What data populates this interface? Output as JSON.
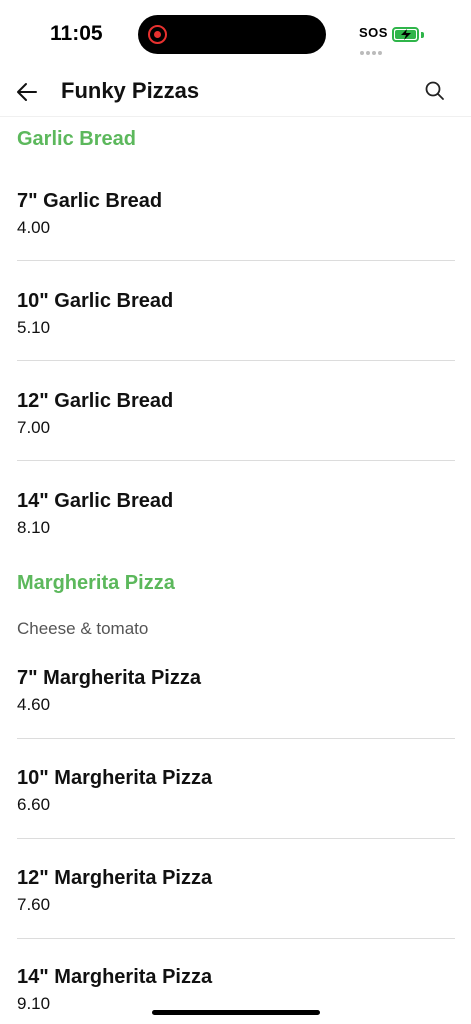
{
  "status": {
    "time": "11:05",
    "sos": "SOS"
  },
  "header": {
    "title": "Funky Pizzas"
  },
  "sections": [
    {
      "title": "Garlic Bread",
      "items": [
        {
          "name": "7\" Garlic Bread",
          "price": "4.00"
        },
        {
          "name": "10\" Garlic Bread",
          "price": "5.10"
        },
        {
          "name": "12\" Garlic Bread",
          "price": "7.00"
        },
        {
          "name": "14\" Garlic Bread",
          "price": "8.10"
        }
      ]
    },
    {
      "title": "Margherita Pizza",
      "description": "Cheese & tomato",
      "items": [
        {
          "name": "7\" Margherita Pizza",
          "price": "4.60"
        },
        {
          "name": "10\" Margherita Pizza",
          "price": "6.60"
        },
        {
          "name": "12\" Margherita Pizza",
          "price": "7.60"
        },
        {
          "name": "14\" Margherita Pizza",
          "price": "9.10"
        }
      ]
    }
  ],
  "colors": {
    "accent": "#5cb85c",
    "battery": "#2fb54a",
    "recording": "#e8312f"
  }
}
